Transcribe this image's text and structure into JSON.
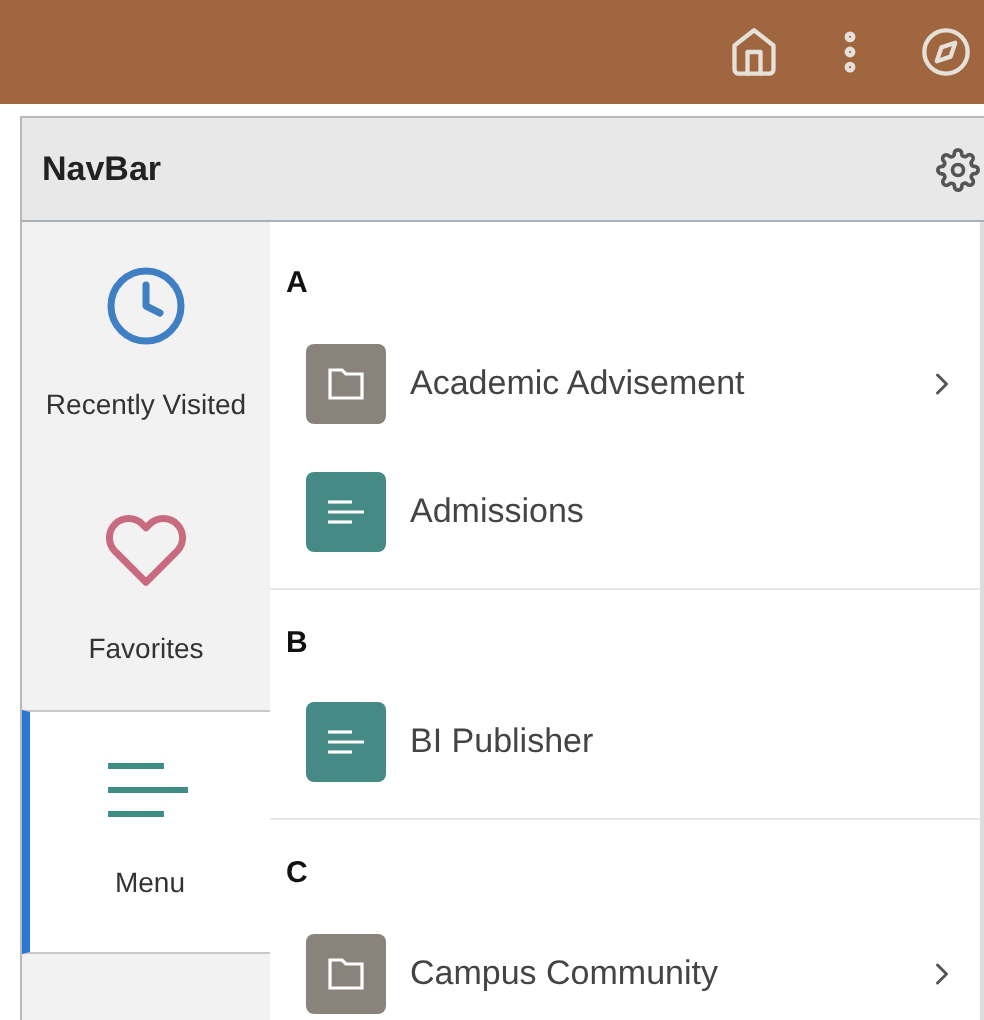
{
  "header": {
    "title": "NavBar"
  },
  "sidebar": {
    "items": [
      {
        "label": "Recently Visited",
        "kind": "clock",
        "selected": false
      },
      {
        "label": "Favorites",
        "kind": "heart",
        "selected": false
      },
      {
        "label": "Menu",
        "kind": "menu",
        "selected": true
      }
    ]
  },
  "sections": [
    {
      "letter": "A",
      "items": [
        {
          "label": "Academic Advisement",
          "kind": "folder"
        },
        {
          "label": "Admissions",
          "kind": "page"
        }
      ]
    },
    {
      "letter": "B",
      "items": [
        {
          "label": "BI Publisher",
          "kind": "page"
        }
      ]
    },
    {
      "letter": "C",
      "items": [
        {
          "label": "Campus Community",
          "kind": "folder"
        }
      ]
    }
  ]
}
